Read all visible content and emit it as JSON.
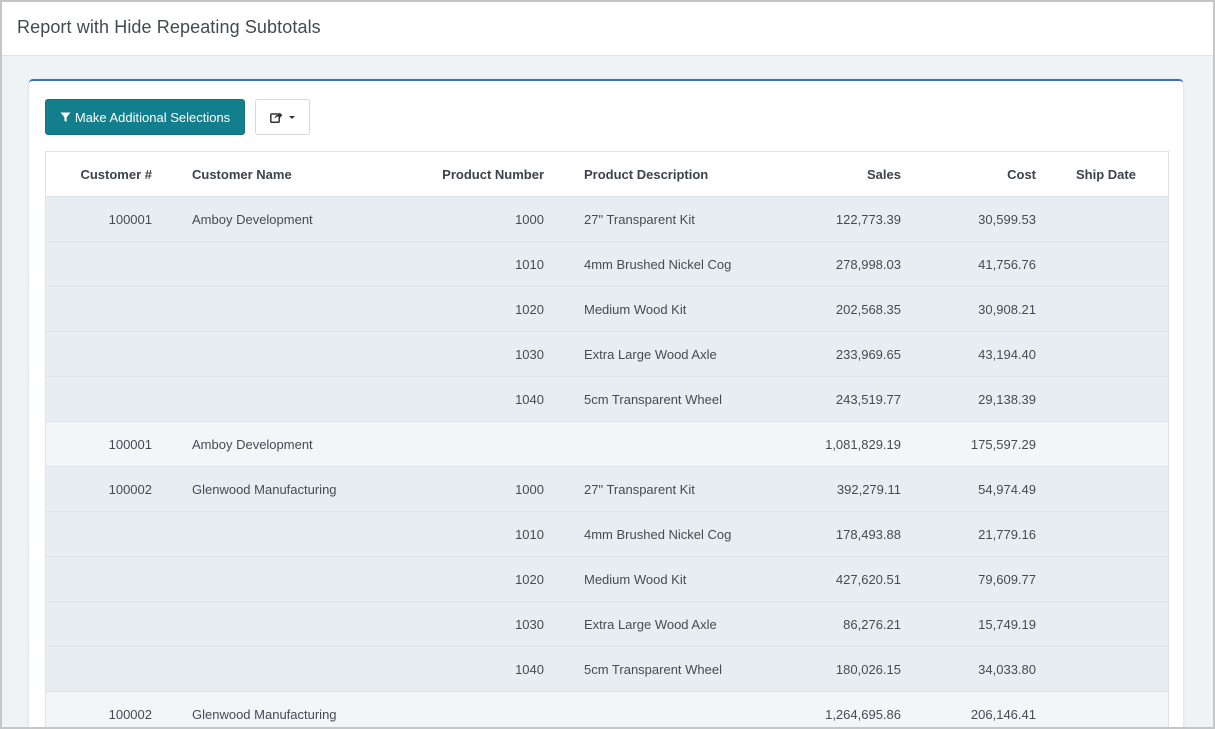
{
  "page": {
    "title": "Report with Hide Repeating Subtotals"
  },
  "toolbar": {
    "selections_label": "Make Additional Selections"
  },
  "colors": {
    "accent": "#137f8d",
    "panel_border": "#3c73b4",
    "detail_row": "#e8edf1",
    "subtotal_row": "#f3f6f9"
  },
  "icons": {
    "selections_button": "filter-icon",
    "share_button": "share-icon"
  },
  "table": {
    "columns": [
      "Customer #",
      "Customer Name",
      "Product Number",
      "Product Description",
      "Sales",
      "Cost",
      "Ship Date"
    ],
    "rows": [
      {
        "type": "detail",
        "cells": [
          "100001",
          "Amboy Development",
          "1000",
          "27\" Transparent Kit",
          "122,773.39",
          "30,599.53",
          ""
        ]
      },
      {
        "type": "detail",
        "cells": [
          "",
          "",
          "1010",
          "4mm Brushed Nickel Cog",
          "278,998.03",
          "41,756.76",
          ""
        ]
      },
      {
        "type": "detail",
        "cells": [
          "",
          "",
          "1020",
          "Medium Wood Kit",
          "202,568.35",
          "30,908.21",
          ""
        ]
      },
      {
        "type": "detail",
        "cells": [
          "",
          "",
          "1030",
          "Extra Large Wood Axle",
          "233,969.65",
          "43,194.40",
          ""
        ]
      },
      {
        "type": "detail",
        "cells": [
          "",
          "",
          "1040",
          "5cm Transparent Wheel",
          "243,519.77",
          "29,138.39",
          ""
        ]
      },
      {
        "type": "subtotal",
        "cells": [
          "100001",
          "Amboy Development",
          "",
          "",
          "1,081,829.19",
          "175,597.29",
          ""
        ]
      },
      {
        "type": "detail",
        "cells": [
          "100002",
          "Glenwood Manufacturing",
          "1000",
          "27\" Transparent Kit",
          "392,279.11",
          "54,974.49",
          ""
        ]
      },
      {
        "type": "detail",
        "cells": [
          "",
          "",
          "1010",
          "4mm Brushed Nickel Cog",
          "178,493.88",
          "21,779.16",
          ""
        ]
      },
      {
        "type": "detail",
        "cells": [
          "",
          "",
          "1020",
          "Medium Wood Kit",
          "427,620.51",
          "79,609.77",
          ""
        ]
      },
      {
        "type": "detail",
        "cells": [
          "",
          "",
          "1030",
          "Extra Large Wood Axle",
          "86,276.21",
          "15,749.19",
          ""
        ]
      },
      {
        "type": "detail",
        "cells": [
          "",
          "",
          "1040",
          "5cm Transparent Wheel",
          "180,026.15",
          "34,033.80",
          ""
        ]
      },
      {
        "type": "subtotal",
        "cells": [
          "100002",
          "Glenwood Manufacturing",
          "",
          "",
          "1,264,695.86",
          "206,146.41",
          ""
        ]
      }
    ]
  }
}
